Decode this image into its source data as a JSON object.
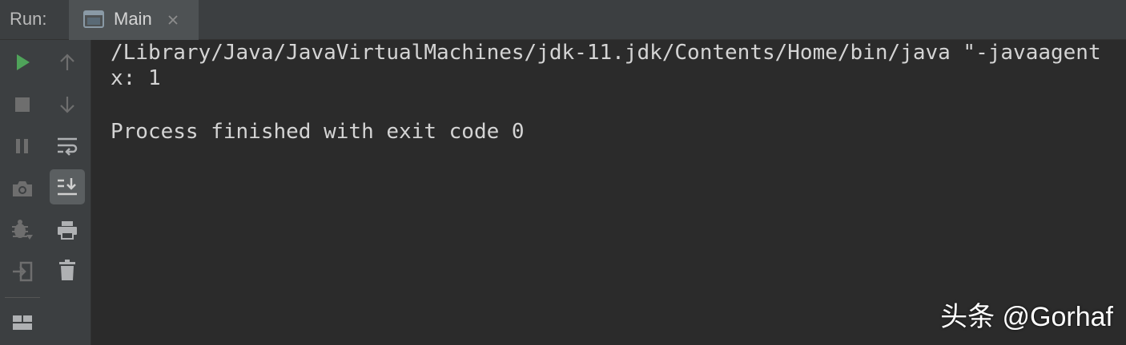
{
  "header": {
    "run_label": "Run:",
    "tab_label": "Main",
    "tab_icon": "console-window-icon",
    "tab_close_icon": "close-icon"
  },
  "toolbar_left": [
    {
      "name": "run-button",
      "icon": "play-icon",
      "color": "#4fa35a"
    },
    {
      "name": "stop-button",
      "icon": "stop-icon",
      "color": "#6e6e6e"
    },
    {
      "name": "pause-button",
      "icon": "pause-icon",
      "color": "#6e6e6e"
    },
    {
      "name": "screenshot-button",
      "icon": "camera-icon",
      "color": "#6e6e6e"
    },
    {
      "name": "debug-button",
      "icon": "bug-icon",
      "color": "#6e6e6e"
    },
    {
      "name": "exit-button",
      "icon": "exit-icon",
      "color": "#6e6e6e"
    },
    {
      "name": "layout-button",
      "icon": "layout-icon",
      "color": "#afb1b3"
    }
  ],
  "toolbar_right": [
    {
      "name": "scroll-up-button",
      "icon": "arrow-up-icon"
    },
    {
      "name": "scroll-down-button",
      "icon": "arrow-down-icon"
    },
    {
      "name": "soft-wrap-button",
      "icon": "soft-wrap-icon"
    },
    {
      "name": "scroll-to-end-button",
      "icon": "scroll-to-end-icon",
      "selected": true
    },
    {
      "name": "print-button",
      "icon": "printer-icon"
    },
    {
      "name": "clear-all-button",
      "icon": "trash-icon"
    }
  ],
  "console": {
    "lines": [
      "/Library/Java/JavaVirtualMachines/jdk-11.jdk/Contents/Home/bin/java \"-javaagent",
      "x: 1",
      "",
      "Process finished with exit code 0"
    ]
  },
  "watermark": "头条 @Gorhaf",
  "colors": {
    "toolbar_bg": "#3c3f41",
    "console_bg": "#2b2b2b",
    "text": "#d4d4d4",
    "run_green": "#4fa35a"
  }
}
